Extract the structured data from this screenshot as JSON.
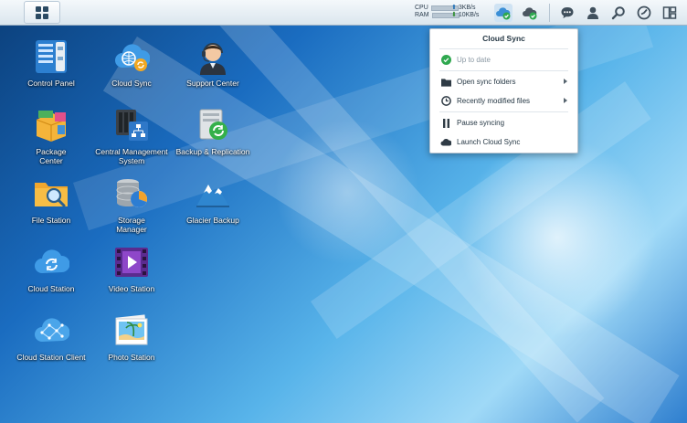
{
  "taskbar": {
    "resource_monitor": {
      "cpu_label": "CPU",
      "ram_label": "RAM"
    },
    "network": {
      "upload": "3KB/s",
      "download": "10KB/s"
    }
  },
  "desktop": {
    "icons": [
      {
        "label": "Control Panel"
      },
      {
        "label": "Cloud Sync"
      },
      {
        "label": "Support Center"
      },
      {
        "label": "Package Center"
      },
      {
        "label": "Central Management System"
      },
      {
        "label": "Backup & Replication"
      },
      {
        "label": "File Station"
      },
      {
        "label": "Storage Manager"
      },
      {
        "label": "Glacier Backup"
      },
      {
        "label": "Cloud Station"
      },
      {
        "label": "Video Station"
      },
      {
        "label": "Cloud Station Client"
      },
      {
        "label": "Photo Station"
      }
    ]
  },
  "popup": {
    "title": "Cloud Sync",
    "status": "Up to date",
    "items": [
      {
        "label": "Open sync folders"
      },
      {
        "label": "Recently modified files"
      },
      {
        "label": "Pause syncing"
      },
      {
        "label": "Launch Cloud Sync"
      }
    ]
  },
  "colors": {
    "accent": "#1d6fb5",
    "status_ok": "#2fa84f"
  }
}
